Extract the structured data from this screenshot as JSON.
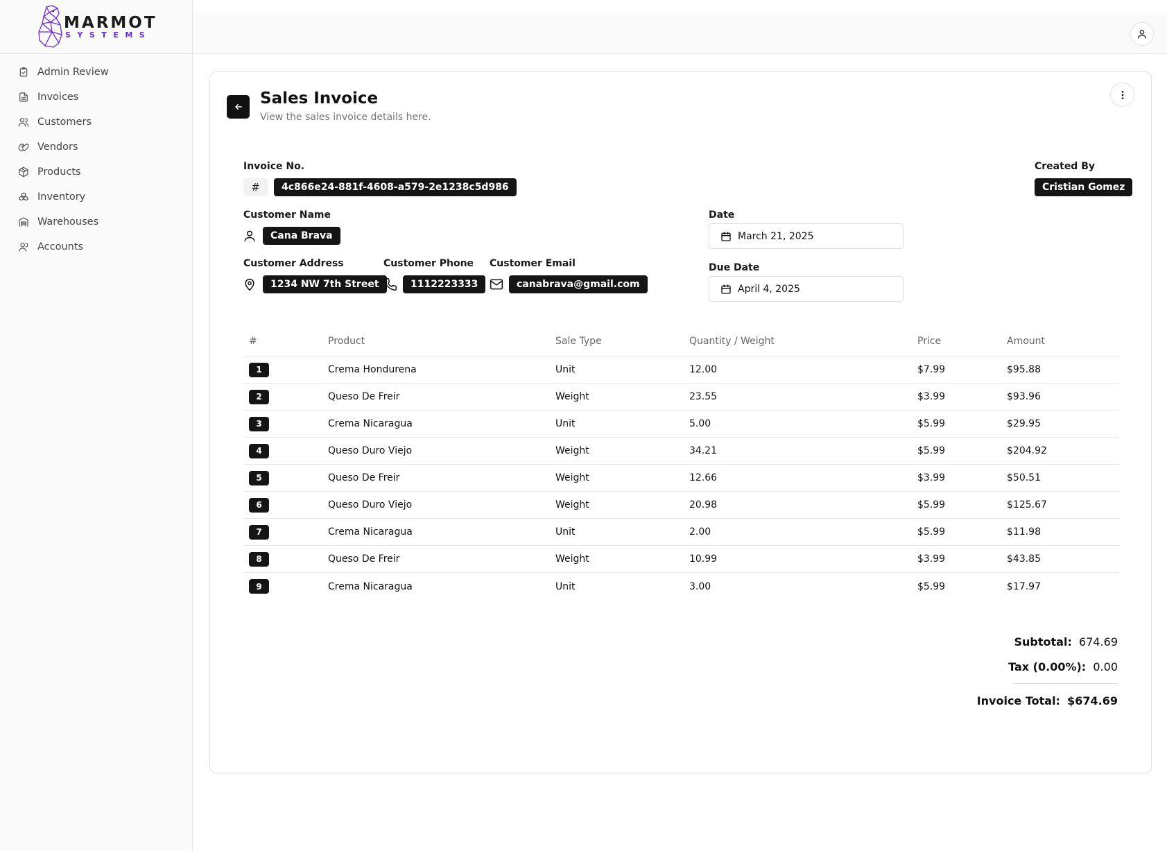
{
  "brand": {
    "word1": "MARMOT",
    "word2": "SYSTEMS",
    "accent": "#6a2bd9"
  },
  "sidebar": {
    "items": [
      {
        "label": "Admin Review",
        "icon": "clipboard-check-icon"
      },
      {
        "label": "Invoices",
        "icon": "file-text-icon"
      },
      {
        "label": "Customers",
        "icon": "users-icon"
      },
      {
        "label": "Vendors",
        "icon": "handshake-icon"
      },
      {
        "label": "Products",
        "icon": "package-icon"
      },
      {
        "label": "Inventory",
        "icon": "boxes-icon"
      },
      {
        "label": "Warehouses",
        "icon": "warehouse-icon"
      },
      {
        "label": "Accounts",
        "icon": "user-group-icon"
      }
    ]
  },
  "header": {
    "user_icon": "user-icon"
  },
  "invoice": {
    "title": "Sales Invoice",
    "subtitle": "View the sales invoice details here.",
    "invoice_no_label": "Invoice No.",
    "invoice_no_prefix": "#",
    "invoice_no": "4c866e24-881f-4608-a579-2e1238c5d986",
    "created_by_label": "Created By",
    "created_by": "Cristian Gomez",
    "customer_name_label": "Customer Name",
    "customer_name": "Cana Brava",
    "customer_address_label": "Customer Address",
    "customer_address": "1234 NW 7th Street",
    "customer_phone_label": "Customer Phone",
    "customer_phone": "1112223333",
    "customer_email_label": "Customer Email",
    "customer_email": "canabrava@gmail.com",
    "date_label": "Date",
    "date": "March 21, 2025",
    "due_date_label": "Due Date",
    "due_date": "April 4, 2025"
  },
  "table": {
    "headers": [
      "#",
      "Product",
      "Sale Type",
      "Quantity / Weight",
      "Price",
      "Amount"
    ],
    "rows": [
      [
        "1",
        "Crema Hondurena",
        "Unit",
        "12.00",
        "$7.99",
        "$95.88"
      ],
      [
        "2",
        "Queso De Freir",
        "Weight",
        "23.55",
        "$3.99",
        "$93.96"
      ],
      [
        "3",
        "Crema Nicaragua",
        "Unit",
        "5.00",
        "$5.99",
        "$29.95"
      ],
      [
        "4",
        "Queso Duro Viejo",
        "Weight",
        "34.21",
        "$5.99",
        "$204.92"
      ],
      [
        "5",
        "Queso De Freir",
        "Weight",
        "12.66",
        "$3.99",
        "$50.51"
      ],
      [
        "6",
        "Queso Duro Viejo",
        "Weight",
        "20.98",
        "$5.99",
        "$125.67"
      ],
      [
        "7",
        "Crema Nicaragua",
        "Unit",
        "2.00",
        "$5.99",
        "$11.98"
      ],
      [
        "8",
        "Queso De Freir",
        "Weight",
        "10.99",
        "$3.99",
        "$43.85"
      ],
      [
        "9",
        "Crema Nicaragua",
        "Unit",
        "3.00",
        "$5.99",
        "$17.97"
      ]
    ]
  },
  "totals": {
    "subtotal_label": "Subtotal:",
    "subtotal": "674.69",
    "tax_label": "Tax (0.00%):",
    "tax": "0.00",
    "total_label": "Invoice Total:",
    "total": "$674.69"
  }
}
